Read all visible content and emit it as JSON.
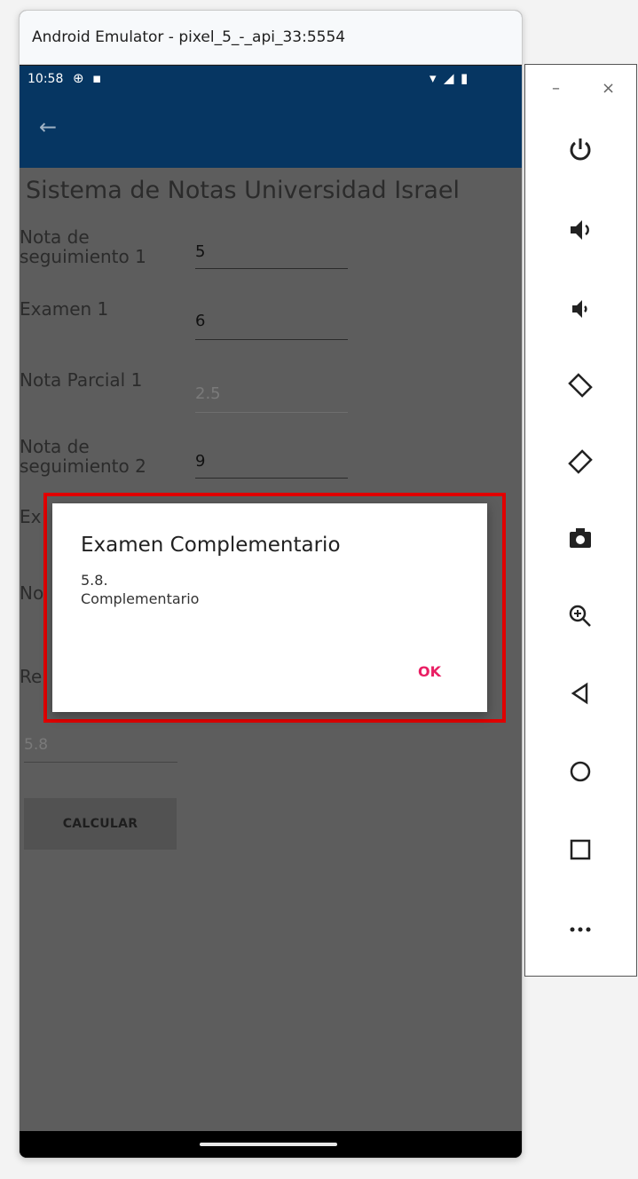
{
  "window": {
    "title": "Android Emulator - pixel_5_-_api_33:5554"
  },
  "status_bar": {
    "time": "10:58"
  },
  "app": {
    "title": "Sistema de Notas Universidad Israel"
  },
  "form": {
    "nota_seguimiento_1": {
      "label": "Nota de\nseguimiento 1",
      "value": "5"
    },
    "examen_1": {
      "label": "Examen 1",
      "value": "6"
    },
    "nota_parcial_1": {
      "label": "Nota Parcial 1",
      "value": "2.5"
    },
    "nota_seguimiento_2": {
      "label": "Nota de\nseguimiento 2",
      "value": "9"
    },
    "examen_2_partial": "Ex",
    "nota_parcial_2_partial": "No",
    "resultado_partial": "Re",
    "resultado_value": "5.8",
    "calcular_button": "CALCULAR"
  },
  "dialog": {
    "title": "Examen Complementario",
    "message": "5.8.\nComplementario",
    "ok_button": "OK"
  },
  "toolbar": {
    "minimize": "–",
    "close": "×"
  },
  "colors": {
    "accent": "#e91e63",
    "status_bar": "#063662",
    "highlight": "#e00000"
  }
}
